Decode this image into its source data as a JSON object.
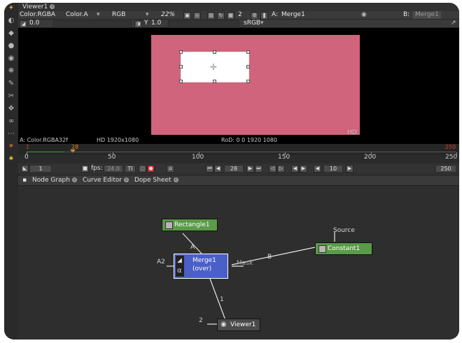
{
  "viewer": {
    "tab_title": "Viewer1",
    "layer": "Color.RGBA",
    "alpha_channel": "Color.A",
    "display_channels": "RGB",
    "zoom": "22%",
    "proxy_level": "2",
    "input_a_label": "A:",
    "input_a_value": "Merge1",
    "input_b_label": "B:",
    "input_b_value": "Merge1",
    "gain": "0.0",
    "gamma_label": "Y",
    "gamma": "1.0",
    "colorspace": "sRGB",
    "info_left": "A: Color.RGBA32f",
    "info_format": "HD 1920x1080",
    "info_rod": "RoD: 0 0 1920 1080",
    "format_tag": "HD"
  },
  "timeline": {
    "current_frame_marker": "28",
    "end_frame_marker": "250",
    "start_frame_marker": "1",
    "ticks": [
      "0",
      "50",
      "100",
      "150",
      "200",
      "250"
    ],
    "first_frame": "1",
    "fps_label": "fps:",
    "fps": "24.0",
    "tl_button": "TI",
    "frame_value": "28",
    "step_value": "10",
    "last_frame": "250"
  },
  "panel_tabs": [
    "Node Graph",
    "Curve Editor",
    "Dope Sheet"
  ],
  "nodes": {
    "rectangle": "Rectangle1",
    "constant": "Constant1",
    "merge_line1": "Merge1",
    "merge_line2": "(over)",
    "viewer": "Viewer1"
  },
  "edge_labels": {
    "a2": "A2",
    "a": "A",
    "b": "B",
    "mask": "Mask",
    "source": "Source",
    "one": "1",
    "two": "2"
  },
  "colors": {
    "frame": "#d0647c",
    "rectangle_node": "#5a9a48",
    "merge_node": "#4a5fc8",
    "constant_node": "#5a9a48",
    "marker_orange": "#e08a20",
    "marker_red": "#d0402a"
  }
}
